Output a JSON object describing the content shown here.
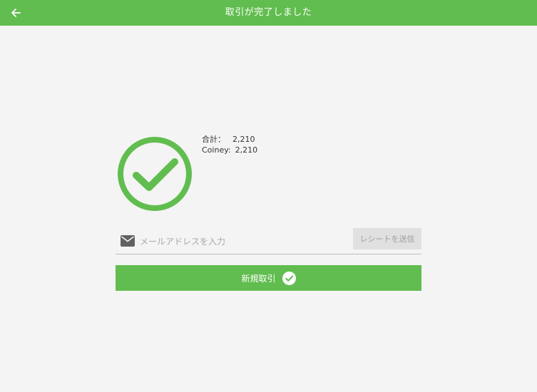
{
  "header": {
    "title": "取引が完了しました",
    "back_icon": "arrow-left-icon"
  },
  "summary": {
    "total_label": "合計：",
    "total_value": "2,210",
    "coiney_label": "Coiney:",
    "coiney_value": "2,210"
  },
  "receipt": {
    "email_placeholder": "メールアドレスを入力",
    "email_value": "",
    "send_label": "レシートを送信"
  },
  "actions": {
    "new_transaction_label": "新規取引"
  },
  "colors": {
    "primary": "#61bd4f",
    "background": "#f4f4f4",
    "disabled_button": "#e0e0e0"
  }
}
